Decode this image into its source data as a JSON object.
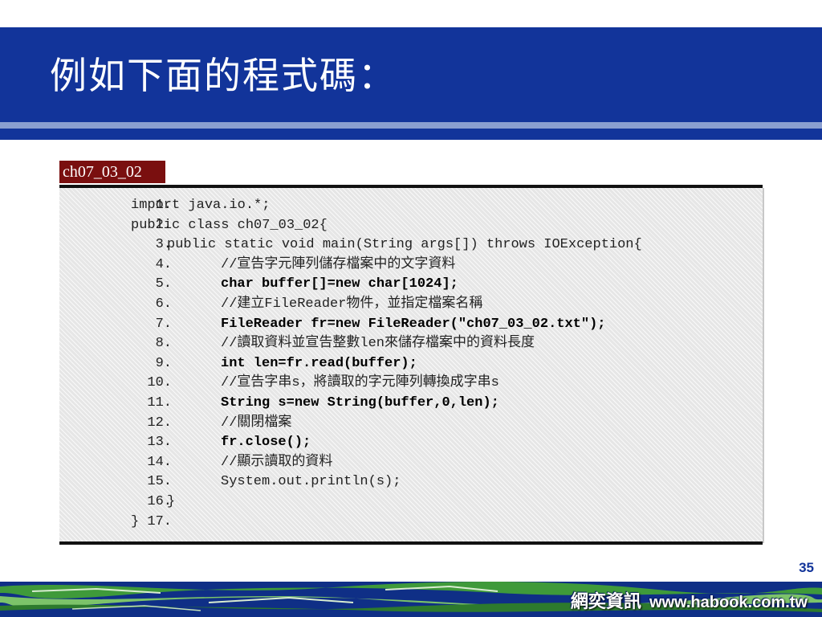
{
  "slide": {
    "title": "例如下面的程式碼：",
    "code_label": "ch07_03_02",
    "page_number": "35"
  },
  "code": {
    "lines": [
      {
        "num": "1.",
        "indent": 0,
        "text": "import java.io.*;",
        "bold": false
      },
      {
        "num": "2.",
        "indent": 0,
        "text": "public class ch07_03_02{",
        "bold": false
      },
      {
        "num": "3.",
        "indent": 1,
        "text": "public static void main(String args[]) throws IOException{",
        "bold": false
      },
      {
        "num": "4.",
        "indent": 2,
        "text": "//宣告字元陣列儲存檔案中的文字資料",
        "bold": false
      },
      {
        "num": "5.",
        "indent": 2,
        "text": "char buffer[]=new char[1024];",
        "bold": true
      },
      {
        "num": "6.",
        "indent": 2,
        "text": "//建立FileReader物件，並指定檔案名稱",
        "bold": false
      },
      {
        "num": "7.",
        "indent": 2,
        "text": "FileReader fr=new FileReader(\"ch07_03_02.txt\");",
        "bold": true
      },
      {
        "num": "8.",
        "indent": 2,
        "text": "//讀取資料並宣告整數len來儲存檔案中的資料長度",
        "bold": false
      },
      {
        "num": "9.",
        "indent": 2,
        "text": "int len=fr.read(buffer);",
        "bold": true
      },
      {
        "num": "10.",
        "indent": 2,
        "text": "//宣告字串s，將讀取的字元陣列轉換成字串s",
        "bold": false
      },
      {
        "num": "11.",
        "indent": 2,
        "text": "String s=new String(buffer,0,len);",
        "bold": true
      },
      {
        "num": "12.",
        "indent": 2,
        "text": "//關閉檔案",
        "bold": false
      },
      {
        "num": "13.",
        "indent": 2,
        "text": "fr.close();",
        "bold": true
      },
      {
        "num": "14.",
        "indent": 2,
        "text": "//顯示讀取的資料",
        "bold": false
      },
      {
        "num": "15.",
        "indent": 2,
        "text": "System.out.println(s);",
        "bold": false
      },
      {
        "num": "16.",
        "indent": 1,
        "text": "}",
        "bold": false
      },
      {
        "num": "17.",
        "indent": 0,
        "text": "}",
        "bold": false
      }
    ]
  },
  "footer": {
    "logo_text": "網奕資訊",
    "url": "www.habook.com.tw"
  },
  "colors": {
    "header_blue": "#12349a",
    "code_label_red": "#7a0f0f"
  }
}
